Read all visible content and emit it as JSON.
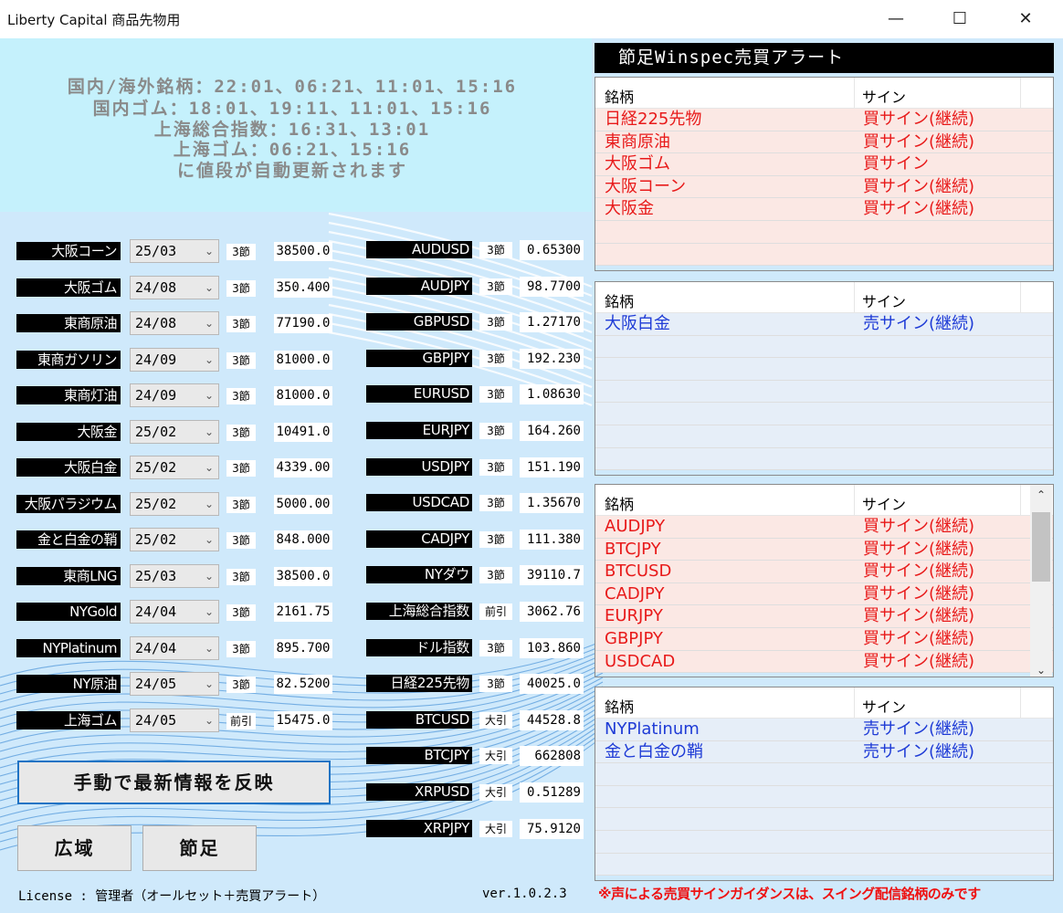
{
  "window": {
    "title": "Liberty Capital 商品先物用",
    "min_icon": "—",
    "max_icon": "☐",
    "close_icon": "✕"
  },
  "info": {
    "lines": [
      "国内/海外銘柄：22:01、06:21、11:01、15:16",
      "国内ゴム：18:01、19:11、11:01、15:16",
      "上海総合指数：16:31、13:01",
      "上海ゴム：06:21、15:16",
      "に値段が自動更新されます"
    ]
  },
  "left_rows": [
    {
      "name": "大阪コーン",
      "contract": "25/03",
      "type": "3節",
      "value": "38500.0"
    },
    {
      "name": "大阪ゴム",
      "contract": "24/08",
      "type": "3節",
      "value": "350.400"
    },
    {
      "name": "東商原油",
      "contract": "24/08",
      "type": "3節",
      "value": "77190.0"
    },
    {
      "name": "東商ガソリン",
      "contract": "24/09",
      "type": "3節",
      "value": "81000.0"
    },
    {
      "name": "東商灯油",
      "contract": "24/09",
      "type": "3節",
      "value": "81000.0"
    },
    {
      "name": "大阪金",
      "contract": "25/02",
      "type": "3節",
      "value": "10491.0"
    },
    {
      "name": "大阪白金",
      "contract": "25/02",
      "type": "3節",
      "value": "4339.00"
    },
    {
      "name": "大阪パラジウム",
      "contract": "25/02",
      "type": "3節",
      "value": "5000.00"
    },
    {
      "name": "金と白金の鞘",
      "contract": "25/02",
      "type": "3節",
      "value": "848.000"
    },
    {
      "name": "東商LNG",
      "contract": "25/03",
      "type": "3節",
      "value": "38500.0"
    },
    {
      "name": "NYGold",
      "contract": "24/04",
      "type": "3節",
      "value": "2161.75"
    },
    {
      "name": "NYPlatinum",
      "contract": "24/04",
      "type": "3節",
      "value": "895.700"
    },
    {
      "name": "NY原油",
      "contract": "24/05",
      "type": "3節",
      "value": "82.5200"
    },
    {
      "name": "上海ゴム",
      "contract": "24/05",
      "type": "前引",
      "value": "15475.0"
    }
  ],
  "right_rows": [
    {
      "name": "AUDUSD",
      "type": "3節",
      "value": "0.65300"
    },
    {
      "name": "AUDJPY",
      "type": "3節",
      "value": "98.7700"
    },
    {
      "name": "GBPUSD",
      "type": "3節",
      "value": "1.27170"
    },
    {
      "name": "GBPJPY",
      "type": "3節",
      "value": "192.230"
    },
    {
      "name": "EURUSD",
      "type": "3節",
      "value": "1.08630"
    },
    {
      "name": "EURJPY",
      "type": "3節",
      "value": "164.260"
    },
    {
      "name": "USDJPY",
      "type": "3節",
      "value": "151.190"
    },
    {
      "name": "USDCAD",
      "type": "3節",
      "value": "1.35670"
    },
    {
      "name": "CADJPY",
      "type": "3節",
      "value": "111.380"
    },
    {
      "name": "NYダウ",
      "type": "3節",
      "value": "39110.7"
    },
    {
      "name": "上海総合指数",
      "type": "前引",
      "value": "3062.76"
    },
    {
      "name": "ドル指数",
      "type": "3節",
      "value": "103.860"
    },
    {
      "name": "日経225先物",
      "type": "3節",
      "value": "40025.0"
    },
    {
      "name": "BTCUSD",
      "type": "大引",
      "value": "44528.8"
    },
    {
      "name": "BTCJPY",
      "type": "大引",
      "value": "662808"
    },
    {
      "name": "XRPUSD",
      "type": "大引",
      "value": "0.51289"
    },
    {
      "name": "XRPJPY",
      "type": "大引",
      "value": "75.9120"
    }
  ],
  "buttons": {
    "manual": "手動で最新情報を反映",
    "wide": "広域",
    "bar": "節足"
  },
  "footer": {
    "license": "License : 管理者（オールセット＋売買アラート）",
    "version": "ver.1.0.2.3",
    "notice": "※声による売買サインガイダンスは、スイング配信銘柄のみです"
  },
  "alerts": {
    "header": "節足Winspec売買アラート",
    "col_name": "銘柄",
    "col_sign": "サイン",
    "tables": [
      {
        "rows": [
          {
            "name": "日経225先物",
            "sign": "買サイン(継続)"
          },
          {
            "name": "東商原油",
            "sign": "買サイン(継続)"
          },
          {
            "name": "大阪ゴム",
            "sign": "買サイン"
          },
          {
            "name": "大阪コーン",
            "sign": "買サイン(継続)"
          },
          {
            "name": "大阪金",
            "sign": "買サイン(継続)"
          }
        ]
      },
      {
        "rows": [
          {
            "name": "大阪白金",
            "sign": "売サイン(継続)"
          }
        ]
      },
      {
        "rows": [
          {
            "name": "AUDJPY",
            "sign": "買サイン(継続)"
          },
          {
            "name": "BTCJPY",
            "sign": "買サイン(継続)"
          },
          {
            "name": "BTCUSD",
            "sign": "買サイン(継続)"
          },
          {
            "name": "CADJPY",
            "sign": "買サイン(継続)"
          },
          {
            "name": "EURJPY",
            "sign": "買サイン(継続)"
          },
          {
            "name": "GBPJPY",
            "sign": "買サイン(継続)"
          },
          {
            "name": "USDCAD",
            "sign": "買サイン(継続)"
          }
        ]
      },
      {
        "rows": [
          {
            "name": "NYPlatinum",
            "sign": "売サイン(継続)"
          },
          {
            "name": "金と白金の鞘",
            "sign": "売サイン(継続)"
          }
        ]
      }
    ],
    "scroll_up": "⌃",
    "scroll_down": "⌄"
  },
  "colors": {
    "buy": "#e81a1a",
    "sell": "#1e3bd6",
    "accent": "#1f73c4"
  },
  "combo_chevron": "⌄"
}
